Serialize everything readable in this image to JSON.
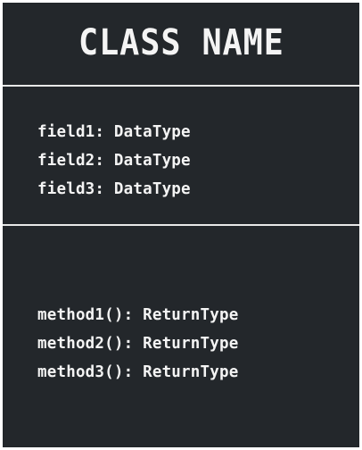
{
  "class_box": {
    "name": "CLASS NAME",
    "fields": [
      "field1: DataType",
      "field2: DataType",
      "field3: DataType"
    ],
    "methods": [
      "method1(): ReturnType",
      "method2(): ReturnType",
      "method3(): ReturnType"
    ]
  },
  "colors": {
    "background": "#23272b",
    "text": "#f4f4f4",
    "divider": "#e8e8e8"
  }
}
